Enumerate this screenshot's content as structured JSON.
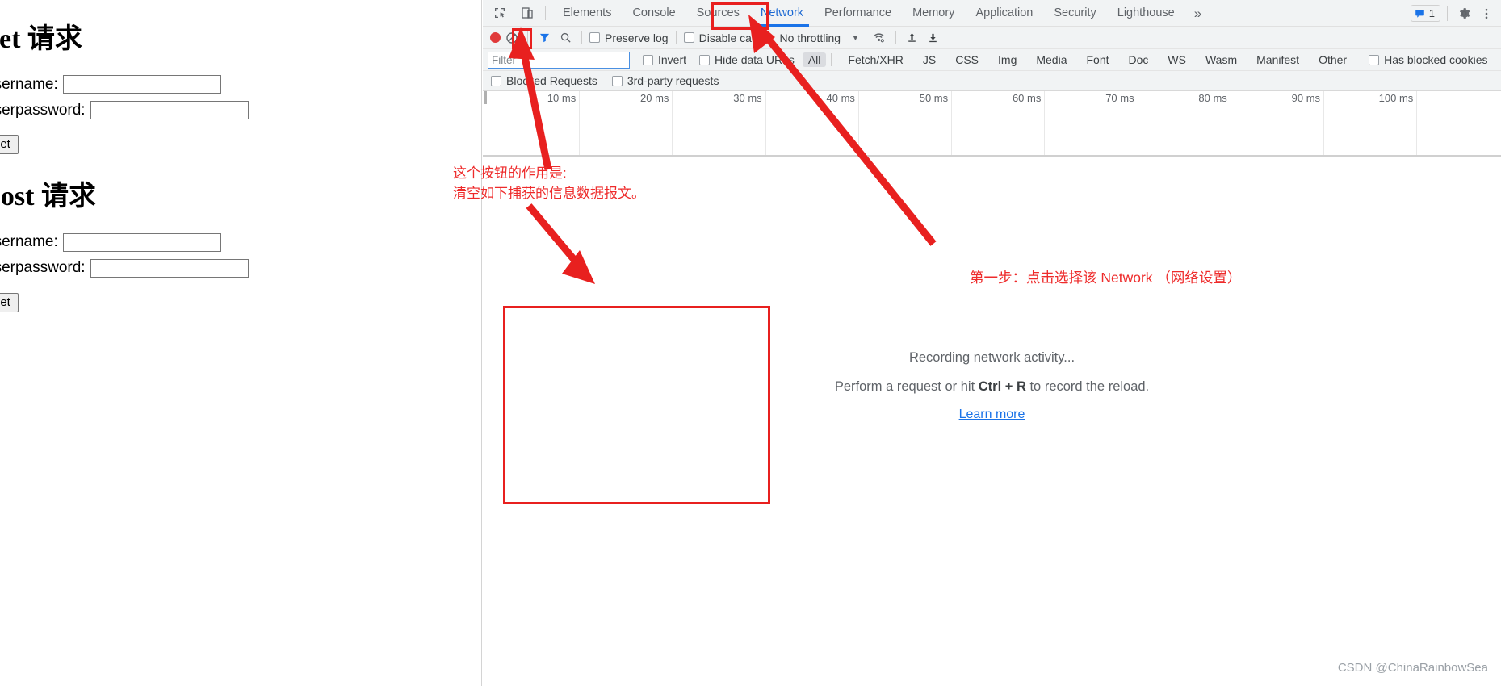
{
  "page": {
    "sections": [
      {
        "heading": "get 请求",
        "username_label": "username:",
        "password_label": "userpassword:",
        "username_value": "",
        "password_value": "",
        "submit_label": "get"
      },
      {
        "heading": "post 请求",
        "username_label": "username:",
        "password_label": "userpassword:",
        "username_value": "",
        "password_value": "",
        "submit_label": "get"
      }
    ]
  },
  "devtools": {
    "tabs": [
      {
        "label": "Elements",
        "active": false
      },
      {
        "label": "Console",
        "active": false
      },
      {
        "label": "Sources",
        "active": false
      },
      {
        "label": "Network",
        "active": true
      },
      {
        "label": "Performance",
        "active": false
      },
      {
        "label": "Memory",
        "active": false
      },
      {
        "label": "Application",
        "active": false
      },
      {
        "label": "Security",
        "active": false
      },
      {
        "label": "Lighthouse",
        "active": false
      }
    ],
    "more_tabs_glyph": "»",
    "message_count": "1",
    "toolbar": {
      "preserve_log_label": "Preserve log",
      "disable_cache_label": "Disable cache",
      "throttling_label": "No throttling"
    },
    "filterbar": {
      "filter_placeholder": "Filter",
      "filter_value": "",
      "invert_label": "Invert",
      "hide_data_urls_label": "Hide data URLs",
      "types": [
        {
          "label": "All",
          "selected": true
        },
        {
          "label": "Fetch/XHR",
          "selected": false
        },
        {
          "label": "JS",
          "selected": false
        },
        {
          "label": "CSS",
          "selected": false
        },
        {
          "label": "Img",
          "selected": false
        },
        {
          "label": "Media",
          "selected": false
        },
        {
          "label": "Font",
          "selected": false
        },
        {
          "label": "Doc",
          "selected": false
        },
        {
          "label": "WS",
          "selected": false
        },
        {
          "label": "Wasm",
          "selected": false
        },
        {
          "label": "Manifest",
          "selected": false
        },
        {
          "label": "Other",
          "selected": false
        }
      ],
      "has_blocked_cookies_label": "Has blocked cookies"
    },
    "thirdbar": {
      "blocked_requests_label": "Blocked Requests",
      "third_party_requests_label": "3rd-party requests"
    },
    "overview": {
      "ticks": [
        "10 ms",
        "20 ms",
        "30 ms",
        "40 ms",
        "50 ms",
        "60 ms",
        "70 ms",
        "80 ms",
        "90 ms",
        "100 ms"
      ]
    },
    "empty_state": {
      "line1": "Recording network activity...",
      "line2_prefix": "Perform a request or hit ",
      "line2_key": "Ctrl + R",
      "line2_suffix": " to record the reload.",
      "link": "Learn more"
    }
  },
  "annotations": {
    "clear_button_note_line1": "这个按钮的作用是:",
    "clear_button_note_line2": "清空如下捕获的信息数据报文。",
    "network_tab_note": "第一步：点击选择该 Network （网络设置）",
    "watermark": "CSDN @ChinaRainbowSea",
    "accent_color": "#e8201f"
  }
}
